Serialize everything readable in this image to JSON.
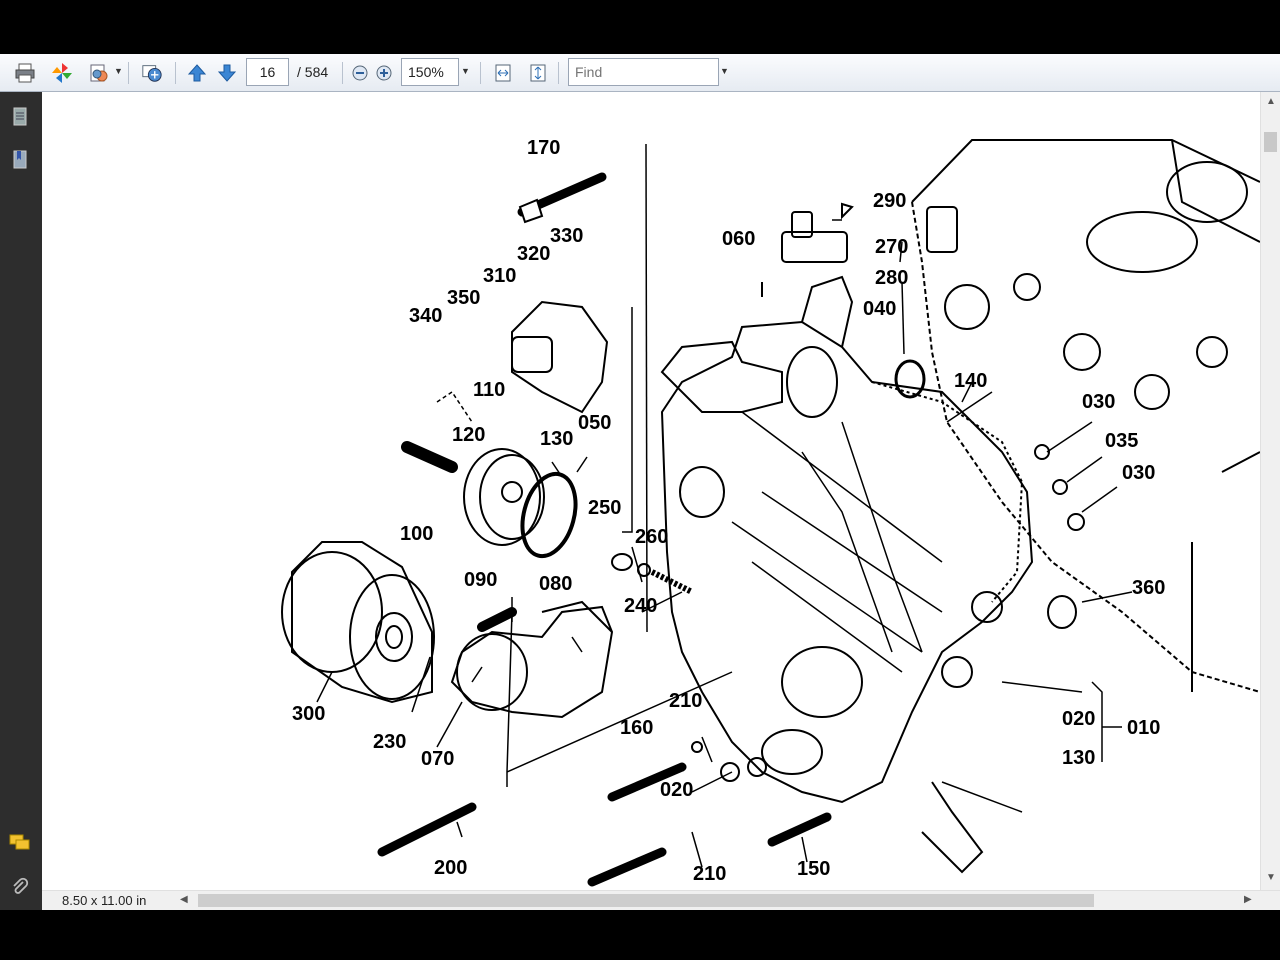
{
  "toolbar": {
    "page_current": "16",
    "page_total": "/ 584",
    "zoom": "150%",
    "find_placeholder": "Find",
    "icons": [
      "print-icon",
      "pinwheel-icon",
      "export-icon",
      "share-icon",
      "prev-page-icon",
      "next-page-icon",
      "zoom-out-icon",
      "zoom-in-icon",
      "fit-width-icon",
      "fit-page-icon"
    ]
  },
  "sidebar": {
    "icons": [
      "pages-icon",
      "bookmarks-icon",
      "comments-icon",
      "attachment-icon"
    ]
  },
  "status": {
    "page_size": "8.50 x 11.00 in"
  },
  "diagram": {
    "labels": [
      "170",
      "290",
      "270",
      "280",
      "060",
      "330",
      "320",
      "310",
      "350",
      "340",
      "040",
      "140",
      "110",
      "120",
      "130",
      "050",
      "030",
      "035",
      "030",
      "100",
      "250",
      "260",
      "240",
      "360",
      "090",
      "080",
      "300",
      "230",
      "070",
      "210",
      "160",
      "020",
      "010",
      "020",
      "130",
      "200",
      "210",
      "150"
    ]
  },
  "colors": {
    "background": "#000000",
    "toolbar": "#e9eef5",
    "sidebar": "#2d2d2d",
    "page": "#ffffff",
    "ink": "#000000"
  }
}
